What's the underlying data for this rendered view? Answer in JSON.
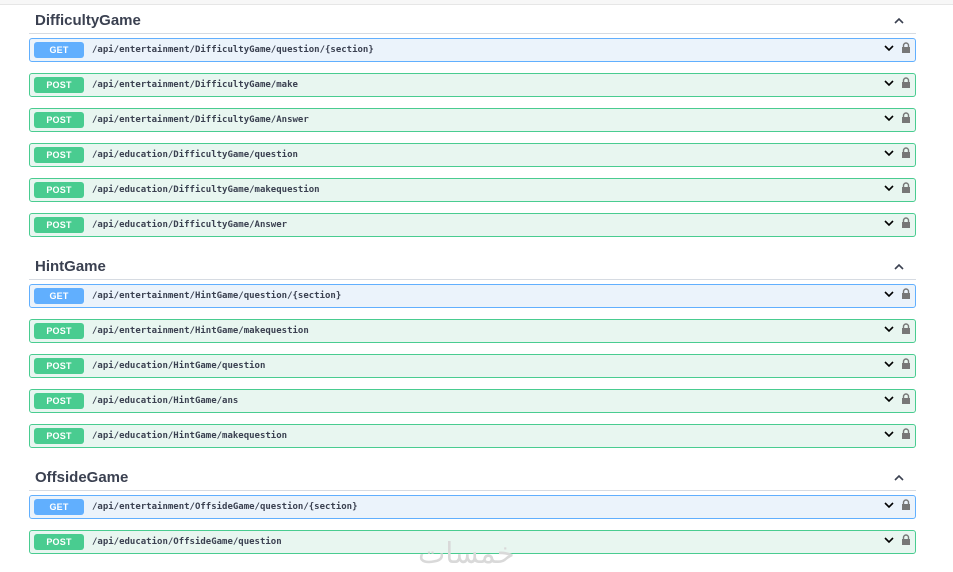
{
  "sections": [
    {
      "title": "DifficultyGame",
      "operations": [
        {
          "method": "GET",
          "path": "/api/entertainment/DifficultyGame/question/{section}"
        },
        {
          "method": "POST",
          "path": "/api/entertainment/DifficultyGame/make"
        },
        {
          "method": "POST",
          "path": "/api/entertainment/DifficultyGame/Answer"
        },
        {
          "method": "POST",
          "path": "/api/education/DifficultyGame/question"
        },
        {
          "method": "POST",
          "path": "/api/education/DifficultyGame/makequestion"
        },
        {
          "method": "POST",
          "path": "/api/education/DifficultyGame/Answer"
        }
      ]
    },
    {
      "title": "HintGame",
      "operations": [
        {
          "method": "GET",
          "path": "/api/entertainment/HintGame/question/{section}"
        },
        {
          "method": "POST",
          "path": "/api/entertainment/HintGame/makequestion"
        },
        {
          "method": "POST",
          "path": "/api/education/HintGame/question"
        },
        {
          "method": "POST",
          "path": "/api/education/HintGame/ans"
        },
        {
          "method": "POST",
          "path": "/api/education/HintGame/makequestion"
        }
      ]
    },
    {
      "title": "OffsideGame",
      "operations": [
        {
          "method": "GET",
          "path": "/api/entertainment/OffsideGame/question/{section}"
        },
        {
          "method": "POST",
          "path": "/api/education/OffsideGame/question"
        }
      ]
    }
  ],
  "watermark": "خمسات",
  "colors": {
    "get": "#61affe",
    "post": "#49cc90",
    "get_bg": "#ebf3fb",
    "post_bg": "#e8f6f0",
    "text": "#3b4151"
  },
  "icons": {
    "collapse": "chevron-up-icon",
    "expand": "chevron-down-icon",
    "lock": "lock-icon"
  }
}
